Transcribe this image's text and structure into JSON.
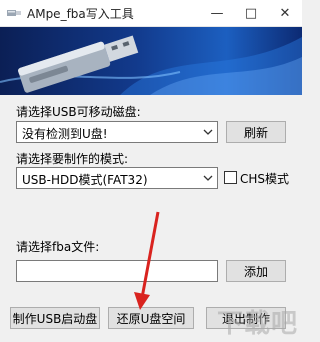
{
  "window": {
    "title": "AMpe_fba写入工具"
  },
  "usb_section": {
    "label": "请选择USB可移动磁盘:",
    "selected": "没有检测到U盘!",
    "refresh_label": "刷新"
  },
  "mode_section": {
    "label": "请选择要制作的模式:",
    "selected": "USB-HDD模式(FAT32)",
    "chs_label": "CHS模式",
    "chs_checked": false
  },
  "fba_section": {
    "label": "请选择fba文件:",
    "value": "",
    "add_label": "添加"
  },
  "actions": {
    "make_label": "制作USB启动盘",
    "restore_label": "还原U盘空间",
    "exit_label": "退出制作"
  },
  "watermark": "下载吧",
  "colors": {
    "arrow": "#d9231f",
    "banner": "#123a8c"
  }
}
